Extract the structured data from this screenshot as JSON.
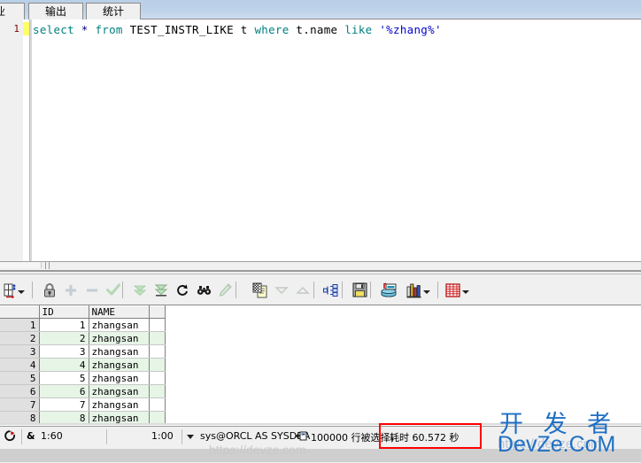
{
  "window": {
    "tabs": [
      {
        "id": "tab-partial",
        "label": "业",
        "active": false
      },
      {
        "id": "tab-output",
        "label": "输出",
        "active": false
      },
      {
        "id": "tab-stats",
        "label": "统计",
        "active": false
      }
    ]
  },
  "editor": {
    "line_number": "1",
    "sql": {
      "t1": "select",
      "t2": " ",
      "t3": "*",
      "t4": " ",
      "t5": "from",
      "t6": " TEST_INSTR_LIKE t ",
      "t7": "where",
      "t8": " t.name ",
      "t9": "like",
      "t10": " ",
      "t11": "'%zhang%'"
    },
    "full_text": "select * from TEST_INSTR_LIKE t where t.name like '%zhang%'"
  },
  "toolbar": {
    "buttons": [
      {
        "name": "grid-view-button",
        "icon": "grid-layout-icon"
      },
      {
        "name": "grid-view-dropdown",
        "icon": "chevron-down-icon"
      },
      {
        "name": "lock-button",
        "icon": "lock-icon"
      },
      {
        "name": "insert-row-button",
        "icon": "plus-icon"
      },
      {
        "name": "delete-row-button",
        "icon": "minus-icon"
      },
      {
        "name": "post-changes-button",
        "icon": "check-icon"
      },
      {
        "name": "fetch-next-page-button",
        "icon": "double-down-arrow-icon"
      },
      {
        "name": "fetch-last-page-button",
        "icon": "down-to-bar-icon"
      },
      {
        "name": "refresh-button",
        "icon": "refresh-icon"
      },
      {
        "name": "find-button",
        "icon": "binoculars-icon"
      },
      {
        "name": "highlight-button",
        "icon": "marker-pen-icon"
      },
      {
        "name": "copy-to-clipboard-button",
        "icon": "copy-document-icon"
      },
      {
        "name": "sort-descending-button",
        "icon": "triangle-down-icon"
      },
      {
        "name": "sort-ascending-button",
        "icon": "triangle-up-icon"
      },
      {
        "name": "query-builder-button",
        "icon": "node-tree-icon"
      },
      {
        "name": "save-button",
        "icon": "floppy-disk-icon"
      },
      {
        "name": "export-data-button",
        "icon": "database-export-icon"
      },
      {
        "name": "chart-button",
        "icon": "bar-chart-icon"
      },
      {
        "name": "chart-dropdown",
        "icon": "chevron-down-icon"
      },
      {
        "name": "grid-style-button",
        "icon": "red-table-icon"
      },
      {
        "name": "grid-style-dropdown",
        "icon": "chevron-down-icon"
      }
    ]
  },
  "results": {
    "columns": [
      "",
      "ID",
      "NAME",
      ""
    ],
    "rows": [
      {
        "rownum": "1",
        "ID": "1",
        "NAME": "zhangsan"
      },
      {
        "rownum": "2",
        "ID": "2",
        "NAME": "zhangsan"
      },
      {
        "rownum": "3",
        "ID": "3",
        "NAME": "zhangsan"
      },
      {
        "rownum": "4",
        "ID": "4",
        "NAME": "zhangsan"
      },
      {
        "rownum": "5",
        "ID": "5",
        "NAME": "zhangsan"
      },
      {
        "rownum": "6",
        "ID": "6",
        "NAME": "zhangsan"
      },
      {
        "rownum": "7",
        "ID": "7",
        "NAME": "zhangsan"
      },
      {
        "rownum": "8",
        "ID": "8",
        "NAME": "zhangsan"
      }
    ]
  },
  "statusbar": {
    "cursor_position": "1:60",
    "record_position": "1:00",
    "connection": "sys@ORCL AS SYSDBA",
    "rows_selected": "100000 行被选择，",
    "elapsed": "耗时 60.572 秒",
    "highlight_color": "#ff0000"
  },
  "watermark": {
    "cn": "开 发 者",
    "en": "DevZe.CoM",
    "faint": "https://devze.com",
    "faint2": "https://devze.com",
    "color": "#1f6fc4"
  }
}
